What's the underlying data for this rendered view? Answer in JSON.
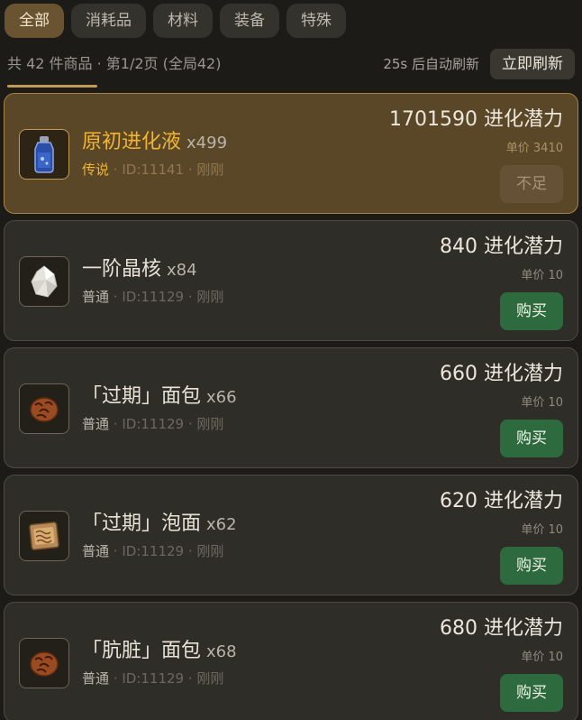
{
  "tabs": [
    "全部",
    "消耗品",
    "材料",
    "装备",
    "特殊"
  ],
  "active_tab": 0,
  "summary": "共 42 件商品 · 第1/2页 (全局42)",
  "auto_refresh": "25s 后自动刷新",
  "refresh_button": "立即刷新",
  "items": [
    {
      "name": "原初进化液",
      "qty": "x499",
      "rarity": "传说",
      "id": "ID:11141",
      "time": "刚刚",
      "total": "1701590 进化潜力",
      "unit_price": "单价 3410",
      "button": "不足",
      "icon": "blue-potion-vial-icon",
      "legendary": true,
      "affordable": false
    },
    {
      "name": "一阶晶核",
      "qty": "x84",
      "rarity": "普通",
      "id": "ID:11129",
      "time": "刚刚",
      "total": "840 进化潜力",
      "unit_price": "单价 10",
      "button": "购买",
      "icon": "white-crystal-core-icon",
      "legendary": false,
      "affordable": true
    },
    {
      "name": "「过期」面包",
      "qty": "x66",
      "rarity": "普通",
      "id": "ID:11129",
      "time": "刚刚",
      "total": "660 进化潜力",
      "unit_price": "单价 10",
      "button": "购买",
      "icon": "bread-loaf-icon",
      "legendary": false,
      "affordable": true
    },
    {
      "name": "「过期」泡面",
      "qty": "x62",
      "rarity": "普通",
      "id": "ID:11129",
      "time": "刚刚",
      "total": "620 进化潜力",
      "unit_price": "单价 10",
      "button": "购买",
      "icon": "instant-noodle-pack-icon",
      "legendary": false,
      "affordable": true
    },
    {
      "name": "「肮脏」面包",
      "qty": "x68",
      "rarity": "普通",
      "id": "ID:11129",
      "time": "刚刚",
      "total": "680 进化潜力",
      "unit_price": "单价 10",
      "button": "购买",
      "icon": "bread-loaf-icon",
      "legendary": false,
      "affordable": true
    }
  ],
  "colors": {
    "accent_gold": "#c19a55",
    "legendary_text": "#f2b431",
    "buy_green": "#2d6b3f",
    "background": "#1c1b18"
  }
}
